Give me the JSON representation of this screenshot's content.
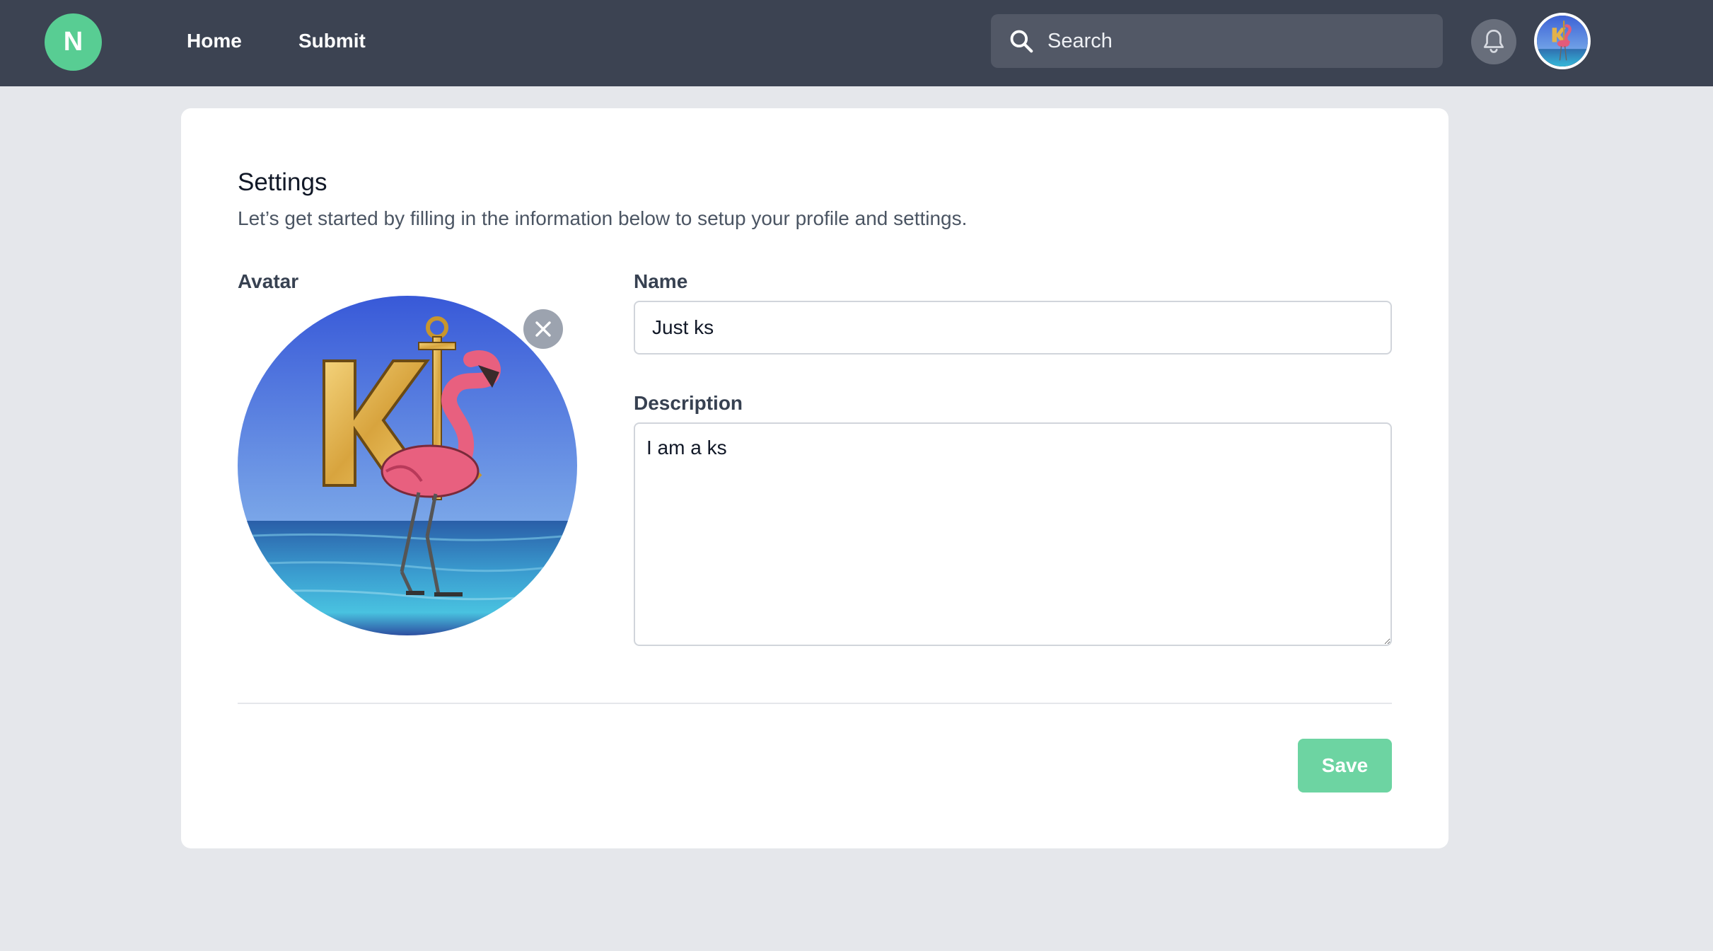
{
  "nav": {
    "logo_letter": "N",
    "links": [
      {
        "label": "Home"
      },
      {
        "label": "Submit"
      }
    ],
    "search_placeholder": "Search",
    "user_avatar_icon": "ks-flamingo-avatar"
  },
  "settings": {
    "title": "Settings",
    "subtitle": "Let’s get started by filling in the information below to setup your profile and settings.",
    "avatar_label": "Avatar",
    "name_label": "Name",
    "name_value": "Just ks",
    "description_label": "Description",
    "description_value": "I am a ks",
    "save_label": "Save",
    "logo_text": "K"
  },
  "colors": {
    "nav_bg": "#3c4352",
    "accent": "#58cd93",
    "save_button": "#6dd4a2",
    "page_bg": "#e5e7eb"
  }
}
